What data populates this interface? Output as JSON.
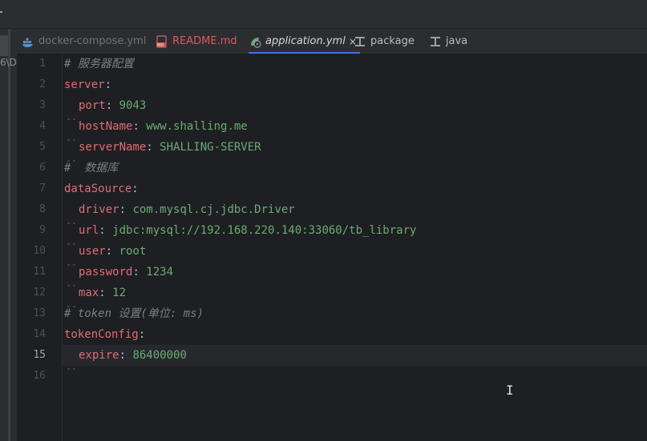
{
  "window": {
    "left_strip_text": "6\\D"
  },
  "tabs": [
    {
      "label": "docker-compose.yml",
      "icon": "docker-icon",
      "state": "dim"
    },
    {
      "label": "README.md",
      "icon": "markdown-file-icon",
      "state": "error"
    },
    {
      "label": "application.yml",
      "icon": "spring-yaml-icon",
      "state": "active",
      "close": "×"
    },
    {
      "label": "package",
      "icon": "class-structure-icon",
      "state": "normal"
    },
    {
      "label": "java",
      "icon": "class-structure-icon",
      "state": "normal"
    }
  ],
  "editor": {
    "current_line": 15,
    "lines": [
      {
        "no": "1",
        "indent": 0,
        "comment": "# 服务器配置"
      },
      {
        "no": "2",
        "indent": 0,
        "key": "server",
        "sep": ":"
      },
      {
        "no": "3",
        "indent": 1,
        "key": "port",
        "sep": ": ",
        "value": "9043"
      },
      {
        "no": "4",
        "indent": 1,
        "key": "hostName",
        "sep": ": ",
        "value": "www.shalling.me"
      },
      {
        "no": "5",
        "indent": 1,
        "key": "serverName",
        "sep": ": ",
        "value": "SHALLING-SERVER"
      },
      {
        "no": "6",
        "indent": 0,
        "comment": "#  数据库"
      },
      {
        "no": "7",
        "indent": 0,
        "key": "dataSource",
        "sep": ":"
      },
      {
        "no": "8",
        "indent": 1,
        "key": "driver",
        "sep": ": ",
        "value": "com.mysql.cj.jdbc.Driver"
      },
      {
        "no": "9",
        "indent": 1,
        "key": "url",
        "sep": ": ",
        "value": "jdbc:mysql://192.168.220.140:33060/tb_library"
      },
      {
        "no": "10",
        "indent": 1,
        "key": "user",
        "sep": ": ",
        "value": "root"
      },
      {
        "no": "11",
        "indent": 1,
        "key": "password",
        "sep": ": ",
        "value": "1234"
      },
      {
        "no": "12",
        "indent": 1,
        "key": "max",
        "sep": ": ",
        "value": "12"
      },
      {
        "no": "13",
        "indent": 0,
        "comment": "# token 设置(单位: ms)"
      },
      {
        "no": "14",
        "indent": 0,
        "key": "tokenConfig",
        "sep": ":"
      },
      {
        "no": "15",
        "indent": 1,
        "key": "expire",
        "sep": ": ",
        "value": "86400000"
      },
      {
        "no": "16",
        "indent": 0
      }
    ]
  },
  "colors": {
    "key": "#e06c75",
    "value": "#6aab73",
    "comment": "#7a7e85",
    "active_tab_underline": "#3574f0",
    "readme_tab": "#db5c5c"
  }
}
